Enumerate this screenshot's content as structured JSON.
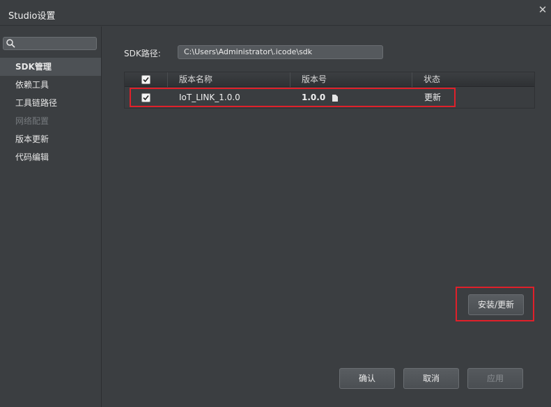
{
  "window": {
    "title": "Studio设置"
  },
  "sidebar": {
    "search_placeholder": "",
    "items": [
      {
        "label": "SDK管理",
        "active": true
      },
      {
        "label": "依赖工具"
      },
      {
        "label": "工具链路径"
      },
      {
        "label": "网络配置",
        "disabled": true
      },
      {
        "label": "版本更新"
      },
      {
        "label": "代码编辑"
      }
    ]
  },
  "sdk": {
    "path_label": "SDK路径:",
    "path_value": "C:\\Users\\Administrator\\.icode\\sdk"
  },
  "table": {
    "columns": [
      "版本名称",
      "版本号",
      "状态"
    ],
    "rows": [
      {
        "checked": true,
        "name": "IoT_LINK_1.0.0",
        "version": "1.0.0",
        "status": "更新"
      }
    ]
  },
  "buttons": {
    "install_update": "安装/更新",
    "confirm": "确认",
    "cancel": "取消",
    "apply": "应用"
  },
  "colors": {
    "highlight": "#e0202a",
    "background": "#3b3e41"
  },
  "icons": [
    "search-icon",
    "close-icon",
    "checkbox-checked-icon",
    "file-icon"
  ]
}
